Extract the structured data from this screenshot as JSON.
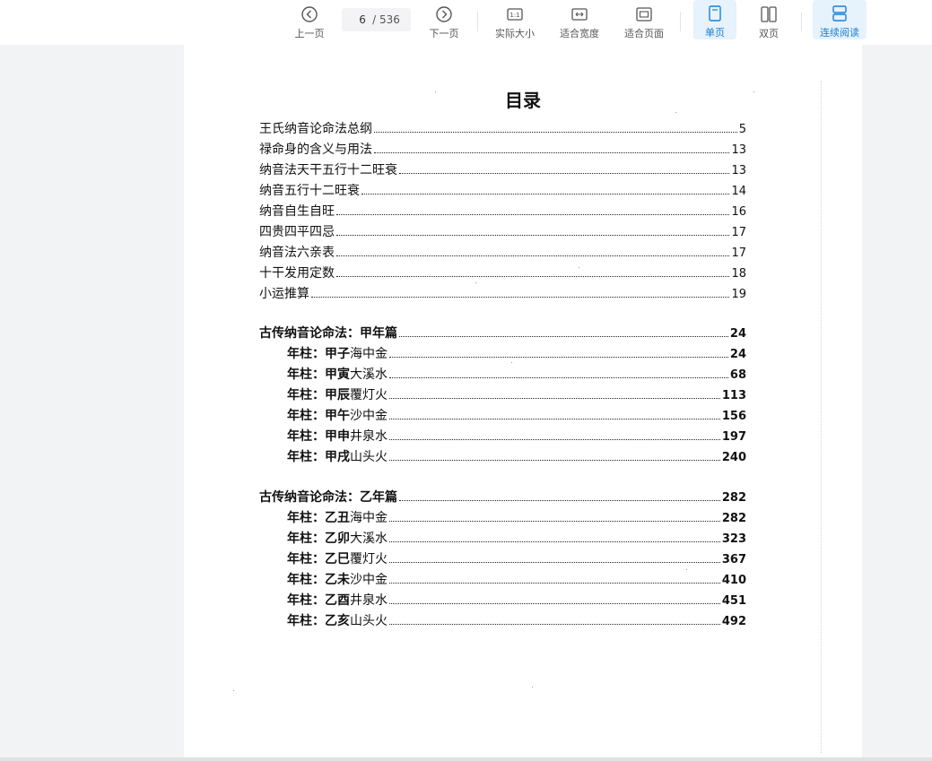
{
  "toolbar": {
    "prev_label": "上一页",
    "next_label": "下一页",
    "current_page": "6",
    "total_pages": "/ 536",
    "actual_size_label": "实际大小",
    "fit_width_label": "适合宽度",
    "fit_page_label": "适合页面",
    "single_page_label": "单页",
    "double_page_label": "双页",
    "continuous_label": "连续阅读",
    "accent_color": "#1a7fd1"
  },
  "document": {
    "title": "目录",
    "section1": [
      {
        "title": "王氏纳音论命法总纲",
        "page": "5"
      },
      {
        "title": "禄命身的含义与用法",
        "page": "13"
      },
      {
        "title": "纳音法天干五行十二旺衰",
        "page": "13"
      },
      {
        "title": "纳音五行十二旺衰",
        "page": "14"
      },
      {
        "title": "纳音自生自旺",
        "page": "16"
      },
      {
        "title": "四贵四平四忌",
        "page": "17"
      },
      {
        "title": "纳音法六亲表",
        "page": "17"
      },
      {
        "title": "十干发用定数",
        "page": "18"
      },
      {
        "title": "小运推算",
        "page": "19"
      }
    ],
    "section2": {
      "heading": "古传纳音论命法：甲年篇",
      "heading_page": "24",
      "items": [
        {
          "title": "年柱：甲子",
          "nayin": "海中金",
          "page": "24"
        },
        {
          "title": "年柱：甲寅",
          "nayin": "大溪水",
          "page": "68"
        },
        {
          "title": "年柱：甲辰",
          "nayin": "覆灯火",
          "page": "113"
        },
        {
          "title": "年柱：甲午",
          "nayin": "沙中金",
          "page": "156"
        },
        {
          "title": "年柱：甲申",
          "nayin": "井泉水",
          "page": "197"
        },
        {
          "title": "年柱：甲戌",
          "nayin": "山头火",
          "page": "240"
        }
      ]
    },
    "section3": {
      "heading": "古传纳音论命法：乙年篇",
      "heading_page": "282",
      "items": [
        {
          "title": "年柱：乙丑",
          "nayin": "海中金",
          "page": "282"
        },
        {
          "title": "年柱：乙卯",
          "nayin": "大溪水",
          "page": "323"
        },
        {
          "title": "年柱：乙巳",
          "nayin": "覆灯火",
          "page": "367"
        },
        {
          "title": "年柱：乙未",
          "nayin": "沙中金",
          "page": "410"
        },
        {
          "title": "年柱：乙酉",
          "nayin": "井泉水",
          "page": "451"
        },
        {
          "title": "年柱：乙亥",
          "nayin": "山头火",
          "page": "492"
        }
      ]
    }
  }
}
